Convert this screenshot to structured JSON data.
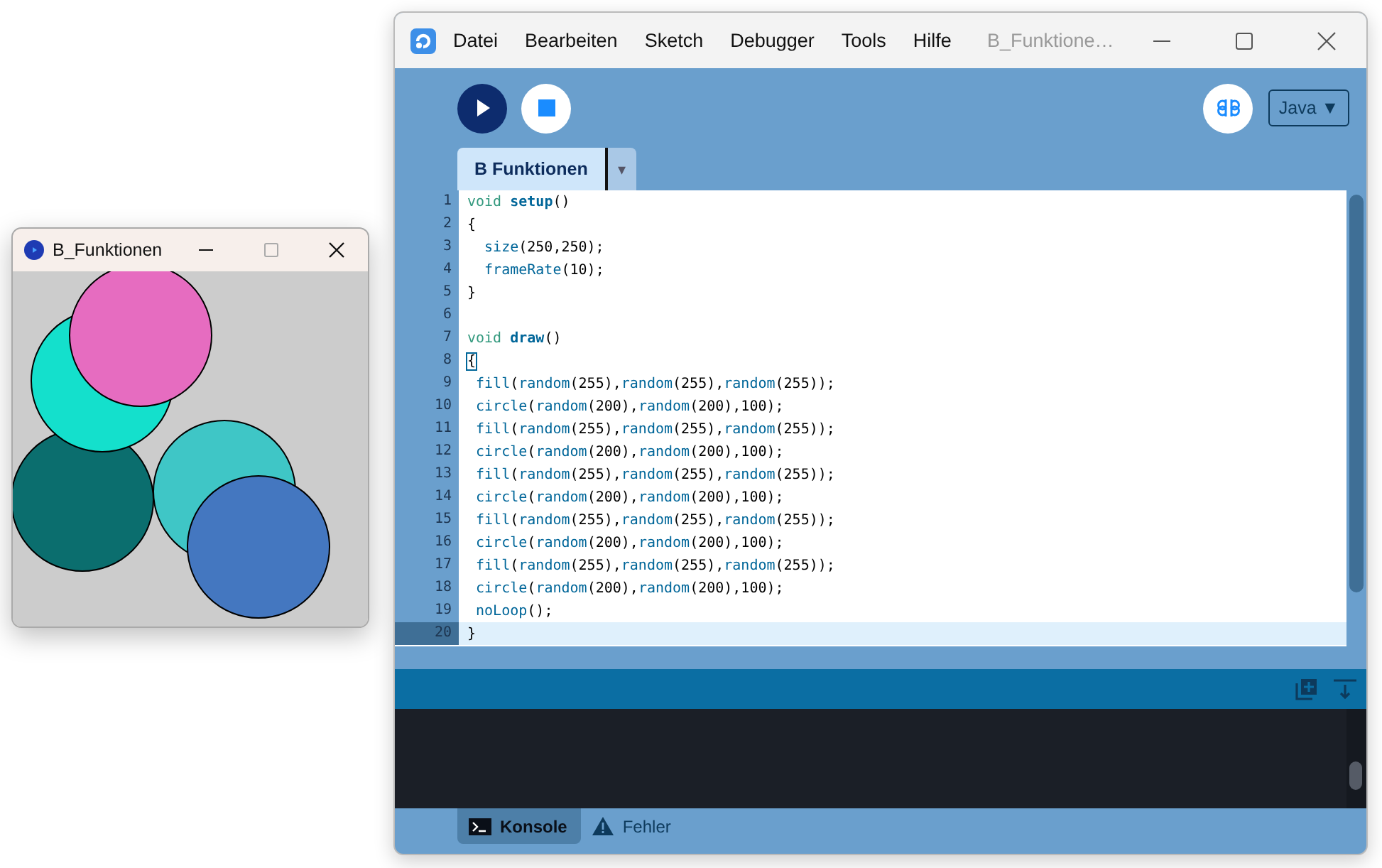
{
  "sketch_window": {
    "title": "B_Funktionen"
  },
  "main_window": {
    "title": "B_Funktione…",
    "menu": [
      "Datei",
      "Bearbeiten",
      "Sketch",
      "Debugger",
      "Tools",
      "Hilfe"
    ],
    "mode": "Java ▼",
    "tabs": [
      {
        "label": "B Funktionen",
        "selected": true
      }
    ],
    "tab_menu": "▾",
    "editor": {
      "lines": [
        {
          "number": "1",
          "current": false,
          "tokens": [
            {
              "text": "void ",
              "kind": "type"
            },
            {
              "text": "setup",
              "kind": "name"
            },
            {
              "text": "()",
              "kind": "plain"
            }
          ]
        },
        {
          "number": "2",
          "current": false,
          "tokens": [
            {
              "text": "{",
              "kind": "plain"
            }
          ]
        },
        {
          "number": "3",
          "current": false,
          "tokens": [
            {
              "text": "  size",
              "kind": "fn"
            },
            {
              "text": "(250,250);",
              "kind": "plain"
            }
          ]
        },
        {
          "number": "4",
          "current": false,
          "tokens": [
            {
              "text": "  frameRate",
              "kind": "fn"
            },
            {
              "text": "(10);",
              "kind": "plain"
            }
          ]
        },
        {
          "number": "5",
          "current": false,
          "tokens": [
            {
              "text": "}",
              "kind": "plain"
            }
          ]
        },
        {
          "number": "6",
          "current": false
        },
        {
          "number": "7",
          "current": false,
          "tokens": [
            {
              "text": "void ",
              "kind": "type"
            },
            {
              "text": "draw",
              "kind": "name"
            },
            {
              "text": "()",
              "kind": "plain"
            }
          ]
        },
        {
          "number": "8",
          "current": false,
          "tokens": [
            {
              "text": "{",
              "kind": "match"
            }
          ]
        },
        {
          "number": "9",
          "current": false,
          "tokens": [
            {
              "text": " fill",
              "kind": "fn"
            },
            {
              "text": "(",
              "kind": "plain"
            },
            {
              "text": "random",
              "kind": "fn"
            },
            {
              "text": "(255),",
              "kind": "plain"
            },
            {
              "text": "random",
              "kind": "fn"
            },
            {
              "text": "(255),",
              "kind": "plain"
            },
            {
              "text": "random",
              "kind": "fn"
            },
            {
              "text": "(255));",
              "kind": "plain"
            }
          ]
        },
        {
          "number": "10",
          "current": false,
          "tokens": [
            {
              "text": " circle",
              "kind": "fn"
            },
            {
              "text": "(",
              "kind": "plain"
            },
            {
              "text": "random",
              "kind": "fn"
            },
            {
              "text": "(200),",
              "kind": "plain"
            },
            {
              "text": "random",
              "kind": "fn"
            },
            {
              "text": "(200),100);",
              "kind": "plain"
            }
          ]
        },
        {
          "number": "11",
          "current": false,
          "tokens": [
            {
              "text": " fill",
              "kind": "fn"
            },
            {
              "text": "(",
              "kind": "plain"
            },
            {
              "text": "random",
              "kind": "fn"
            },
            {
              "text": "(255),",
              "kind": "plain"
            },
            {
              "text": "random",
              "kind": "fn"
            },
            {
              "text": "(255),",
              "kind": "plain"
            },
            {
              "text": "random",
              "kind": "fn"
            },
            {
              "text": "(255));",
              "kind": "plain"
            }
          ]
        },
        {
          "number": "12",
          "current": false,
          "tokens": [
            {
              "text": " circle",
              "kind": "fn"
            },
            {
              "text": "(",
              "kind": "plain"
            },
            {
              "text": "random",
              "kind": "fn"
            },
            {
              "text": "(200),",
              "kind": "plain"
            },
            {
              "text": "random",
              "kind": "fn"
            },
            {
              "text": "(200),100);",
              "kind": "plain"
            }
          ]
        },
        {
          "number": "13",
          "current": false,
          "tokens": [
            {
              "text": " fill",
              "kind": "fn"
            },
            {
              "text": "(",
              "kind": "plain"
            },
            {
              "text": "random",
              "kind": "fn"
            },
            {
              "text": "(255),",
              "kind": "plain"
            },
            {
              "text": "random",
              "kind": "fn"
            },
            {
              "text": "(255),",
              "kind": "plain"
            },
            {
              "text": "random",
              "kind": "fn"
            },
            {
              "text": "(255));",
              "kind": "plain"
            }
          ]
        },
        {
          "number": "14",
          "current": false,
          "tokens": [
            {
              "text": " circle",
              "kind": "fn"
            },
            {
              "text": "(",
              "kind": "plain"
            },
            {
              "text": "random",
              "kind": "fn"
            },
            {
              "text": "(200),",
              "kind": "plain"
            },
            {
              "text": "random",
              "kind": "fn"
            },
            {
              "text": "(200),100);",
              "kind": "plain"
            }
          ]
        },
        {
          "number": "15",
          "current": false,
          "tokens": [
            {
              "text": " fill",
              "kind": "fn"
            },
            {
              "text": "(",
              "kind": "plain"
            },
            {
              "text": "random",
              "kind": "fn"
            },
            {
              "text": "(255),",
              "kind": "plain"
            },
            {
              "text": "random",
              "kind": "fn"
            },
            {
              "text": "(255),",
              "kind": "plain"
            },
            {
              "text": "random",
              "kind": "fn"
            },
            {
              "text": "(255));",
              "kind": "plain"
            }
          ]
        },
        {
          "number": "16",
          "current": false,
          "tokens": [
            {
              "text": " circle",
              "kind": "fn"
            },
            {
              "text": "(",
              "kind": "plain"
            },
            {
              "text": "random",
              "kind": "fn"
            },
            {
              "text": "(200),",
              "kind": "plain"
            },
            {
              "text": "random",
              "kind": "fn"
            },
            {
              "text": "(200),100);",
              "kind": "plain"
            }
          ]
        },
        {
          "number": "17",
          "current": false,
          "tokens": [
            {
              "text": " fill",
              "kind": "fn"
            },
            {
              "text": "(",
              "kind": "plain"
            },
            {
              "text": "random",
              "kind": "fn"
            },
            {
              "text": "(255),",
              "kind": "plain"
            },
            {
              "text": "random",
              "kind": "fn"
            },
            {
              "text": "(255),",
              "kind": "plain"
            },
            {
              "text": "random",
              "kind": "fn"
            },
            {
              "text": "(255));",
              "kind": "plain"
            }
          ]
        },
        {
          "number": "18",
          "current": false,
          "tokens": [
            {
              "text": " circle",
              "kind": "fn"
            },
            {
              "text": "(",
              "kind": "plain"
            },
            {
              "text": "random",
              "kind": "fn"
            },
            {
              "text": "(200),",
              "kind": "plain"
            },
            {
              "text": "random",
              "kind": "fn"
            },
            {
              "text": "(200),100);",
              "kind": "plain"
            }
          ]
        },
        {
          "number": "19",
          "current": false,
          "tokens": [
            {
              "text": " noLoop",
              "kind": "fn"
            },
            {
              "text": "();",
              "kind": "plain"
            }
          ]
        },
        {
          "number": "20",
          "current": true,
          "tokens": [
            {
              "text": "}",
              "kind": "plain"
            }
          ]
        }
      ]
    },
    "console_tabs": [
      {
        "label": "Konsole",
        "selected": true,
        "kind": "console"
      },
      {
        "label": "Fehler",
        "selected": false,
        "kind": "errors"
      }
    ]
  }
}
